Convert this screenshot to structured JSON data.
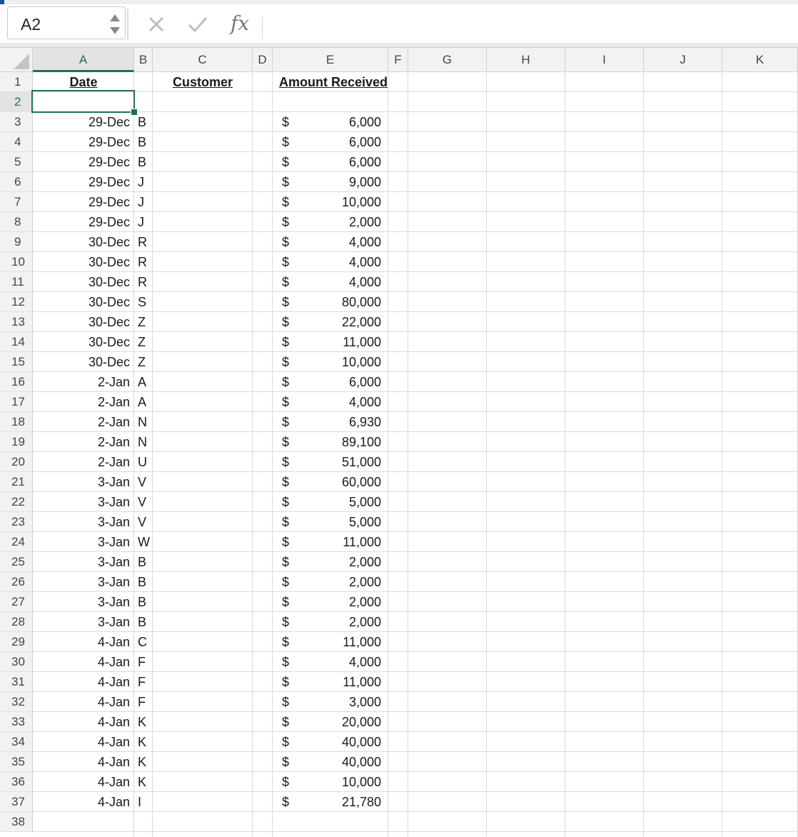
{
  "name_box": {
    "value": "A2"
  },
  "formula_bar": {
    "fx_label": "fx",
    "formula": ""
  },
  "columns": [
    "A",
    "B",
    "C",
    "D",
    "E",
    "F",
    "G",
    "H",
    "I",
    "J",
    "K"
  ],
  "selected_column": "A",
  "selected_cell": "A2",
  "headers": {
    "date": "Date",
    "customer": "Customer",
    "amount": "Amount Received"
  },
  "currency_symbol": "$",
  "rows": [
    {
      "date": "29-Dec",
      "customer": "B",
      "amount": "6,000"
    },
    {
      "date": "29-Dec",
      "customer": "B",
      "amount": "6,000"
    },
    {
      "date": "29-Dec",
      "customer": "B",
      "amount": "6,000"
    },
    {
      "date": "29-Dec",
      "customer": "J",
      "amount": "9,000"
    },
    {
      "date": "29-Dec",
      "customer": "J",
      "amount": "10,000"
    },
    {
      "date": "29-Dec",
      "customer": "J",
      "amount": "2,000"
    },
    {
      "date": "30-Dec",
      "customer": "R",
      "amount": "4,000"
    },
    {
      "date": "30-Dec",
      "customer": "R",
      "amount": "4,000"
    },
    {
      "date": "30-Dec",
      "customer": "R",
      "amount": "4,000"
    },
    {
      "date": "30-Dec",
      "customer": "S",
      "amount": "80,000"
    },
    {
      "date": "30-Dec",
      "customer": "Z",
      "amount": "22,000"
    },
    {
      "date": "30-Dec",
      "customer": "Z",
      "amount": "11,000"
    },
    {
      "date": "30-Dec",
      "customer": "Z",
      "amount": "10,000"
    },
    {
      "date": "2-Jan",
      "customer": "A",
      "amount": "6,000"
    },
    {
      "date": "2-Jan",
      "customer": "A",
      "amount": "4,000"
    },
    {
      "date": "2-Jan",
      "customer": "N",
      "amount": "6,930"
    },
    {
      "date": "2-Jan",
      "customer": "N",
      "amount": "89,100"
    },
    {
      "date": "2-Jan",
      "customer": "U",
      "amount": "51,000"
    },
    {
      "date": "3-Jan",
      "customer": "V",
      "amount": "60,000"
    },
    {
      "date": "3-Jan",
      "customer": "V",
      "amount": "5,000"
    },
    {
      "date": "3-Jan",
      "customer": "V",
      "amount": "5,000"
    },
    {
      "date": "3-Jan",
      "customer": "W",
      "amount": "11,000"
    },
    {
      "date": "3-Jan",
      "customer": "B",
      "amount": "2,000"
    },
    {
      "date": "3-Jan",
      "customer": "B",
      "amount": "2,000"
    },
    {
      "date": "3-Jan",
      "customer": "B",
      "amount": "2,000"
    },
    {
      "date": "3-Jan",
      "customer": "B",
      "amount": "2,000"
    },
    {
      "date": "4-Jan",
      "customer": "C",
      "amount": "11,000"
    },
    {
      "date": "4-Jan",
      "customer": "F",
      "amount": "4,000"
    },
    {
      "date": "4-Jan",
      "customer": "F",
      "amount": "11,000"
    },
    {
      "date": "4-Jan",
      "customer": "F",
      "amount": "3,000"
    },
    {
      "date": "4-Jan",
      "customer": "K",
      "amount": "20,000"
    },
    {
      "date": "4-Jan",
      "customer": "K",
      "amount": "40,000"
    },
    {
      "date": "4-Jan",
      "customer": "K",
      "amount": "40,000"
    },
    {
      "date": "4-Jan",
      "customer": "K",
      "amount": "10,000"
    },
    {
      "date": "4-Jan",
      "customer": "I",
      "amount": "21,780"
    }
  ],
  "accent_color": "#217346"
}
